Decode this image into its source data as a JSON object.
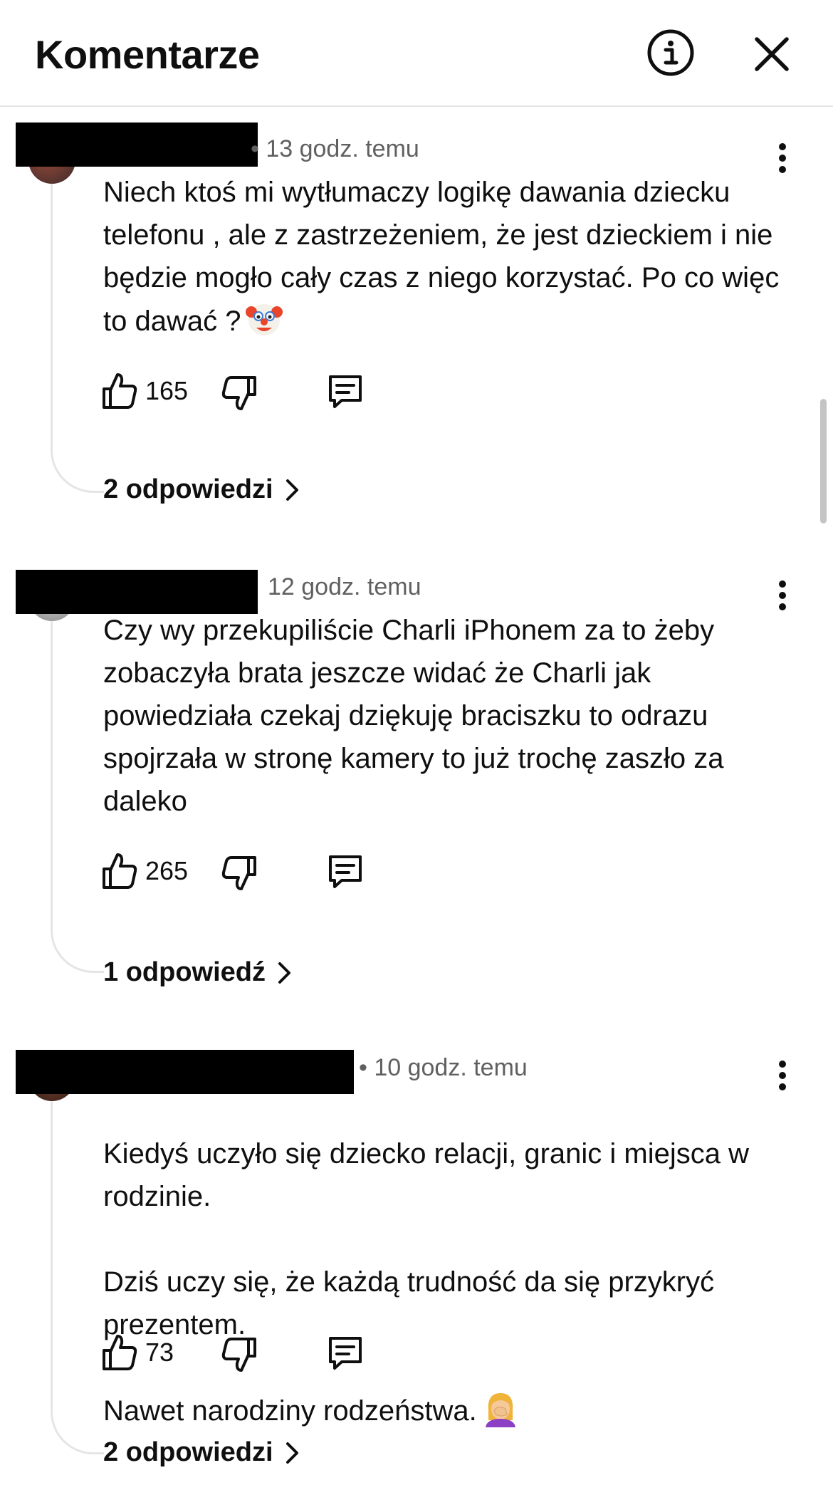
{
  "header": {
    "title": "Komentarze",
    "info_icon": "info-circle-icon",
    "close_icon": "close-icon"
  },
  "comments": [
    {
      "author_redacted": true,
      "time": "• 13 godz. temu",
      "text": "Niech ktoś mi wytłumaczy logikę dawania dziecku telefonu , ale z zastrzeżeniem, że jest dzieckiem i nie będzie mogło cały czas z niego korzystać. Po co więc to dawać ?",
      "emoji": "clown-face-emoji",
      "likes": "165",
      "replies_label": "2 odpowiedzi"
    },
    {
      "author_redacted": true,
      "time": "12 godz. temu",
      "text": "Czy wy przekupiliście Charli iPhonem za to żeby zobaczyła brata jeszcze widać że Charli jak powiedziała czekaj dziękuję braciszku to odrazu spojrzała w stronę kamery to już trochę zaszło za daleko",
      "likes": "265",
      "replies_label": "1 odpowiedź"
    },
    {
      "author_redacted": true,
      "time": "• 10 godz. temu",
      "text_lines": [
        "Kiedyś uczyło się dziecko relacji, granic i miejsca w rodzinie.",
        "Dziś uczy się, że każdą trudność da się przykryć prezentem.",
        "Nawet narodziny rodzeństwa."
      ],
      "emoji": "woman-facepalming-emoji",
      "likes": "73",
      "replies_label": "2 odpowiedzi"
    }
  ],
  "colors": {
    "text": "#0f0f0f",
    "meta": "#606060",
    "divider": "#e5e5e5",
    "redaction": "#000000"
  }
}
